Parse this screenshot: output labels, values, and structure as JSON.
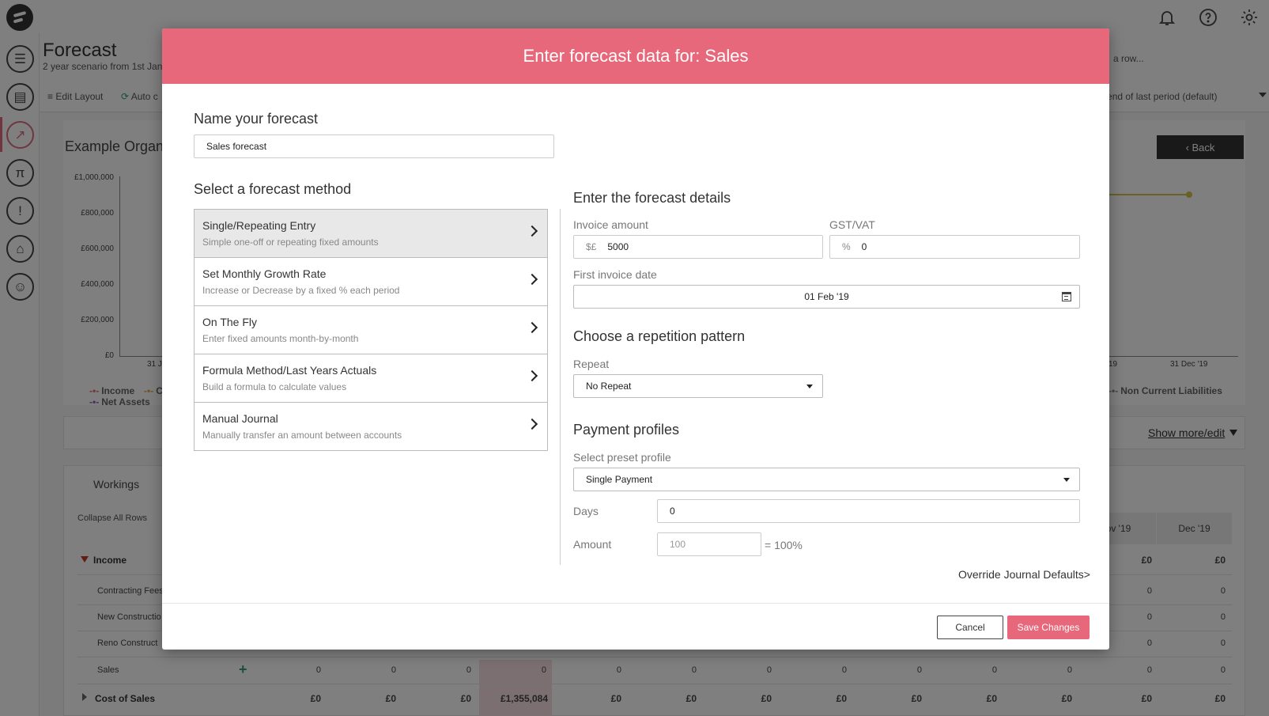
{
  "app": {
    "page_title": "Forecast",
    "page_subtitle": "2 year scenario from 1st Jan",
    "hint_right": "a row...",
    "toolbar": {
      "edit_layout": "Edit Layout",
      "auto": "Auto c",
      "period_select": "the end of last period (default)"
    },
    "org_title": "Example Organ",
    "back_label": "Back",
    "chart": {
      "y_ticks": [
        "£1,000,000",
        "£800,000",
        "£600,000",
        "£400,000",
        "£200,000",
        "£0"
      ],
      "x_ticks": [
        "31 J",
        "19",
        "31 Dec '19"
      ],
      "legend": [
        "Income",
        "C",
        "Net Assets",
        "Non Current Liabilities"
      ]
    },
    "show_more": "Show more/edit",
    "workings": {
      "title": "Workings",
      "collapse_all": "Collapse All Rows",
      "month_headers": [
        "ov '19",
        "Dec '19"
      ],
      "income_label": "Income",
      "income_values": [
        "£0",
        "£0"
      ],
      "rows": [
        {
          "label": "Contracting Fees",
          "values": [
            "0",
            "0"
          ]
        },
        {
          "label": "New Constructio",
          "values": [
            "0",
            "0"
          ]
        },
        {
          "label": "Reno Construct",
          "values": [
            "0",
            "0"
          ]
        }
      ],
      "sales_label": "Sales",
      "sales_values": [
        "0",
        "0",
        "0",
        "0",
        "0",
        "0",
        "0",
        "0",
        "0",
        "0",
        "0",
        "0",
        "0"
      ],
      "cost_label": "Cost of Sales",
      "cost_values": [
        "£0",
        "£0",
        "£0",
        "£1,355,084",
        "£0",
        "£0",
        "£0",
        "£0",
        "£0",
        "£0",
        "£0",
        "£0",
        "£0"
      ]
    }
  },
  "modal": {
    "title": "Enter forecast data for: Sales",
    "name_label": "Name your forecast",
    "name_value": "Sales forecast",
    "method_label": "Select a forecast method",
    "methods": [
      {
        "title": "Single/Repeating Entry",
        "desc": "Simple one-off or repeating fixed amounts"
      },
      {
        "title": "Set Monthly Growth Rate",
        "desc": "Increase or Decrease by a fixed % each period"
      },
      {
        "title": "On The Fly",
        "desc": "Enter fixed amounts month-by-month"
      },
      {
        "title": "Formula Method/Last Years Actuals",
        "desc": "Build a formula to calculate values"
      },
      {
        "title": "Manual Journal",
        "desc": "Manually transfer an amount between accounts"
      }
    ],
    "details_label": "Enter the forecast details",
    "invoice_amount_label": "Invoice amount",
    "invoice_prefix": "$£",
    "invoice_amount_value": "5000",
    "gst_label": "GST/VAT",
    "gst_prefix": "%",
    "gst_value": "0",
    "first_invoice_label": "First invoice date",
    "first_invoice_value": "01 Feb '19",
    "repetition_label": "Choose a repetition pattern",
    "repeat_label": "Repeat",
    "repeat_value": "No Repeat",
    "payment_label": "Payment profiles",
    "preset_label": "Select preset profile",
    "preset_value": "Single Payment",
    "days_label": "Days",
    "days_value": "0",
    "amount_label": "Amount",
    "amount_placeholder": "100",
    "amount_suffix": "= 100%",
    "override_link": "Override Journal Defaults>",
    "cancel_label": "Cancel",
    "save_label": "Save Changes"
  },
  "colors": {
    "accent": "#e8687b",
    "chart_line": "#d5c24b",
    "add_icon": "#2e9c7e"
  }
}
